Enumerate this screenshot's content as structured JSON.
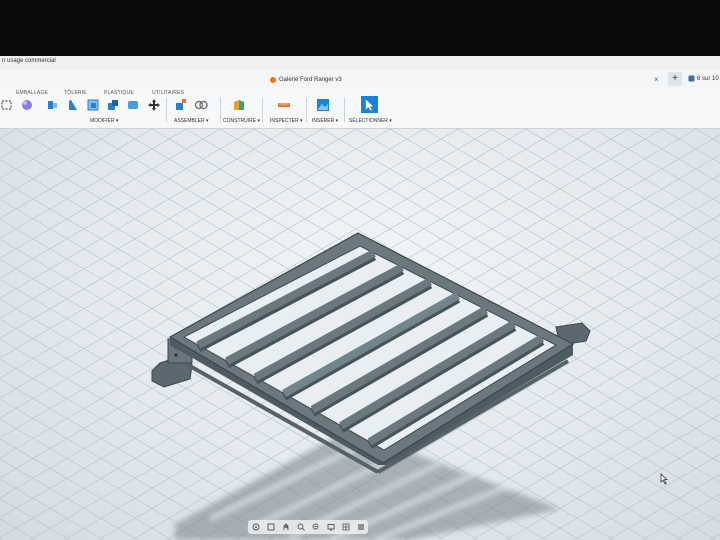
{
  "window": {
    "license_text": "n usage commercial"
  },
  "tabs": {
    "document_title": "Galerie Ford Ranger v3",
    "counter_text": "6 sur 10"
  },
  "ribbon": {
    "tab_names": [
      "EMBALLAGE",
      "TÔLERIE",
      "PLASTIQUE",
      "UTILITAIRES"
    ],
    "groups": [
      "MODIFIER ▾",
      "ASSEMBLER ▾",
      "CONSTRUIRE ▾",
      "INSPECTER ▾",
      "INSÉRER ▾",
      "SÉLECTIONNER ▾"
    ]
  },
  "colors": {
    "accent_blue": "#1c84d6",
    "accent_orange": "#e8742a",
    "model_steel": "#65727a",
    "viewport_bg": "#e6ebef"
  },
  "icons": [
    "sketch-icon",
    "create-form-icon",
    "extrude-icon",
    "press-pull-icon",
    "shell-icon",
    "combine-icon",
    "move-icon",
    "new-component-icon",
    "joint-icon",
    "construct-plane-icon",
    "measure-icon",
    "insert-image-icon",
    "select-icon",
    "orbit-icon",
    "pan-icon",
    "zoom-icon",
    "display-settings-icon"
  ]
}
